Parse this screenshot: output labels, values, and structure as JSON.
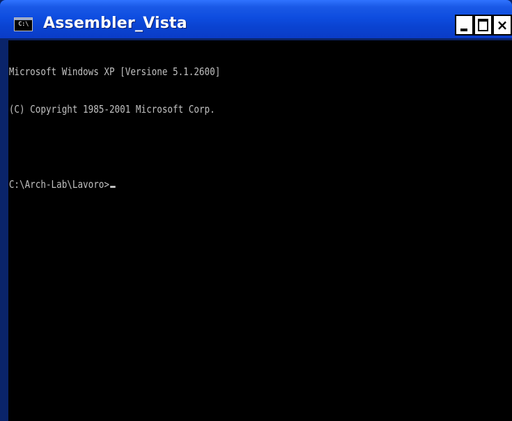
{
  "window": {
    "title": "Assembler_Vista",
    "icon_label": "C:\\"
  },
  "controls": {
    "minimize_icon": "minimize-icon",
    "maximize_icon": "maximize-icon",
    "close_icon": "close-icon",
    "close_glyph": "×"
  },
  "console": {
    "line1": "Microsoft Windows XP [Versione 5.1.2600]",
    "line2": "(C) Copyright 1985-2001 Microsoft Corp.",
    "line3": "",
    "prompt": "C:\\Arch-Lab\\Lavoro>"
  },
  "colors": {
    "titlebar": "#0a43d1",
    "console_bg": "#000000",
    "console_fg": "#c0c0c0"
  }
}
